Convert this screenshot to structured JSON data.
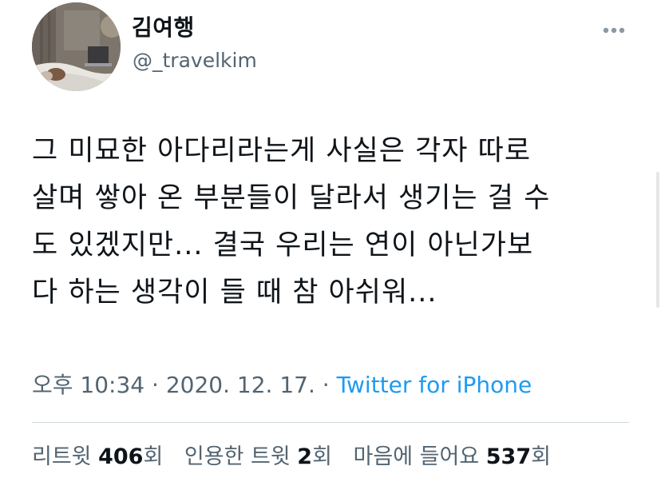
{
  "user": {
    "display_name": "김여행",
    "handle": "@_travelkim"
  },
  "tweet": {
    "lines": [
      "그 미묘한 아다리라는게 사실은 각자 따로",
      "살며 쌓아 온 부분들이 달라서 생기는 걸 수",
      "도 있겠지만... 결국 우리는 연이 아닌가보",
      "다 하는 생각이 들 때 참 아쉬워..."
    ]
  },
  "meta": {
    "time": "오후 10:34",
    "separator": " · ",
    "date": "2020. 12. 17.",
    "separator2": " · ",
    "source": "Twitter for iPhone"
  },
  "stats": {
    "retweets_label": "리트윗 ",
    "retweets": "406",
    "retweets_unit": "회",
    "quotes_label": "인용한 트윗 ",
    "quotes": "2",
    "quotes_unit": "회",
    "likes_label": "마음에 들어요 ",
    "likes": "537",
    "likes_unit": "회"
  },
  "icons": {
    "more": "more-horizontal-icon"
  },
  "colors": {
    "text": "#0f1419",
    "secondary": "#536471",
    "link": "#1d9bf0",
    "divider": "#cfd9de"
  }
}
